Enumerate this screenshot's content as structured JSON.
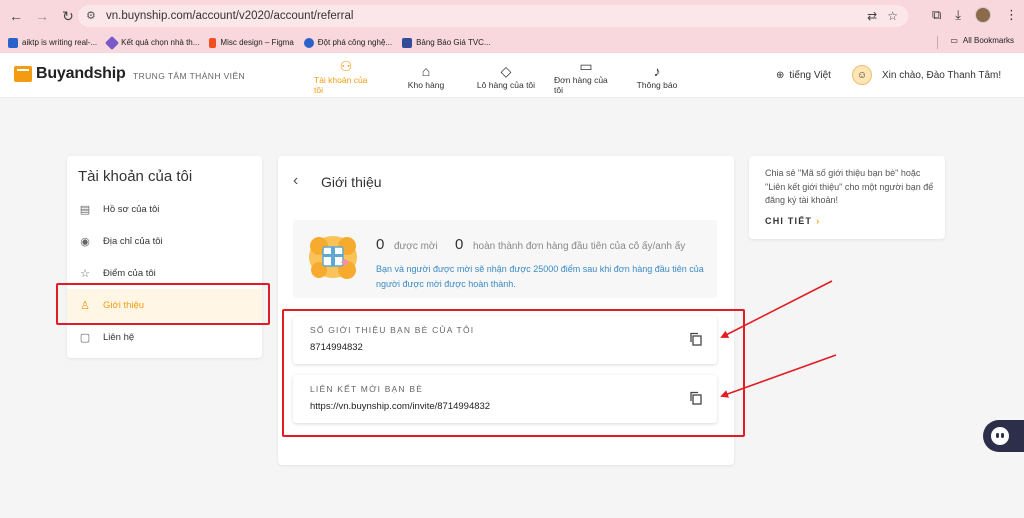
{
  "browser": {
    "url": "vn.buynship.com/account/v2020/account/referral",
    "bookmarks": [
      {
        "label": "aiktp is writing real-...",
        "color": "#2a62c9"
      },
      {
        "label": "Kết quả chọn nhà th...",
        "color": "#7a5ac9"
      },
      {
        "label": "Misc design – Figma",
        "color": "#f24e1e"
      },
      {
        "label": "Đột phá công nghệ...",
        "color": "#2a62c9"
      },
      {
        "label": "Bảng Báo Giá TVC...",
        "color": "#334c99"
      }
    ],
    "all_bookmarks": "All Bookmarks"
  },
  "header": {
    "brand": "Buyandship",
    "subtitle": "TRUNG TÂM THÀNH VIÊN",
    "nav": [
      {
        "label": "Tài khoản của tôi",
        "icon": "person-icon",
        "active": true
      },
      {
        "label": "Kho hàng",
        "icon": "warehouse-icon",
        "active": false
      },
      {
        "label": "Lô hàng của tôi",
        "icon": "box-icon",
        "active": false
      },
      {
        "label": "Đơn hàng của tôi",
        "icon": "truck-icon",
        "active": false
      },
      {
        "label": "Thông báo",
        "icon": "bell-icon",
        "active": false
      }
    ],
    "language": "tiếng Việt",
    "greeting": "Xin chào, Đào Thanh Tâm!"
  },
  "sidebar": {
    "title": "Tài khoản của tôi",
    "items": [
      {
        "label": "Hồ sơ của tôi",
        "icon": "id-card-icon"
      },
      {
        "label": "Địa chỉ của tôi",
        "icon": "location-icon"
      },
      {
        "label": "Điểm của tôi",
        "icon": "star-icon"
      },
      {
        "label": "Giới thiệu",
        "icon": "referral-icon",
        "active": true
      },
      {
        "label": "Liên hệ",
        "icon": "chat-icon"
      }
    ]
  },
  "main": {
    "title": "Giới thiệu",
    "invited_count": "0",
    "invited_label": "được mời",
    "completed_count": "0",
    "completed_label": "hoàn thành đơn hàng đầu tiên của cô ấy/anh ấy",
    "description": "Bạn và người được mời sẽ nhận được 25000 điểm sau khi đơn hàng đầu tiên của người được mời được hoàn thành.",
    "referral_code_label": "SỐ GIỚI THIỆU BẠN BÈ CỦA TÔI",
    "referral_code": "8714994832",
    "invite_link_label": "LIÊN KẾT MỜI BẠN BÈ",
    "invite_link": "https://vn.buynship.com/invite/8714994832"
  },
  "info": {
    "text": "Chia sẻ \"Mã số giới thiệu bạn bè\" hoặc \"Liên kết giới thiệu\" cho một người bạn để đăng ký tài khoản!",
    "link_label": "CHI TIẾT"
  },
  "colors": {
    "accent": "#f39c12",
    "annotation": "#e31c23",
    "link": "#3b8ac4",
    "browser_chrome": "#f8d7dd"
  }
}
